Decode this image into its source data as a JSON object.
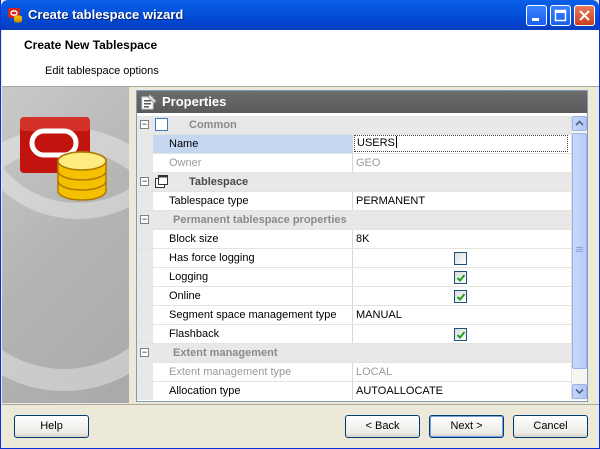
{
  "window": {
    "title": "Create tablespace wizard",
    "icon": "oracle-app-icon"
  },
  "header": {
    "title": "Create New Tablespace",
    "subtitle": "Edit tablespace options"
  },
  "properties": {
    "panel_title": "Properties",
    "rows": [
      {
        "kind": "category",
        "label": "Common",
        "icon": "square-icon"
      },
      {
        "kind": "property",
        "name": "Name",
        "value": "USERS",
        "selected": true,
        "editing": true
      },
      {
        "kind": "property",
        "name": "Owner",
        "value": "GEO",
        "disabled": true
      },
      {
        "kind": "category",
        "label": "Tablespace",
        "icon": "windows-icon",
        "dark": true
      },
      {
        "kind": "property",
        "name": "Tablespace type",
        "value": "PERMANENT"
      },
      {
        "kind": "category",
        "label": "Permanent tablespace properties"
      },
      {
        "kind": "property",
        "name": "Block size",
        "value": "8K"
      },
      {
        "kind": "property",
        "name": "Has force logging",
        "checkbox": true,
        "checked": false
      },
      {
        "kind": "property",
        "name": "Logging",
        "checkbox": true,
        "checked": true
      },
      {
        "kind": "property",
        "name": "Online",
        "checkbox": true,
        "checked": true
      },
      {
        "kind": "property",
        "name": "Segment space management type",
        "value": "MANUAL"
      },
      {
        "kind": "property",
        "name": "Flashback",
        "checkbox": true,
        "checked": true
      },
      {
        "kind": "category",
        "label": "Extent management"
      },
      {
        "kind": "property",
        "name": "Extent management type",
        "value": "LOCAL",
        "disabled": true
      },
      {
        "kind": "property",
        "name": "Allocation type",
        "value": "AUTOALLOCATE"
      }
    ]
  },
  "buttons": {
    "help": "Help",
    "back": "< Back",
    "next": "Next >",
    "cancel": "Cancel"
  },
  "colors": {
    "titlebar": "#0453dc",
    "selected_row": "#c5d6f0",
    "check": "#21a121"
  }
}
